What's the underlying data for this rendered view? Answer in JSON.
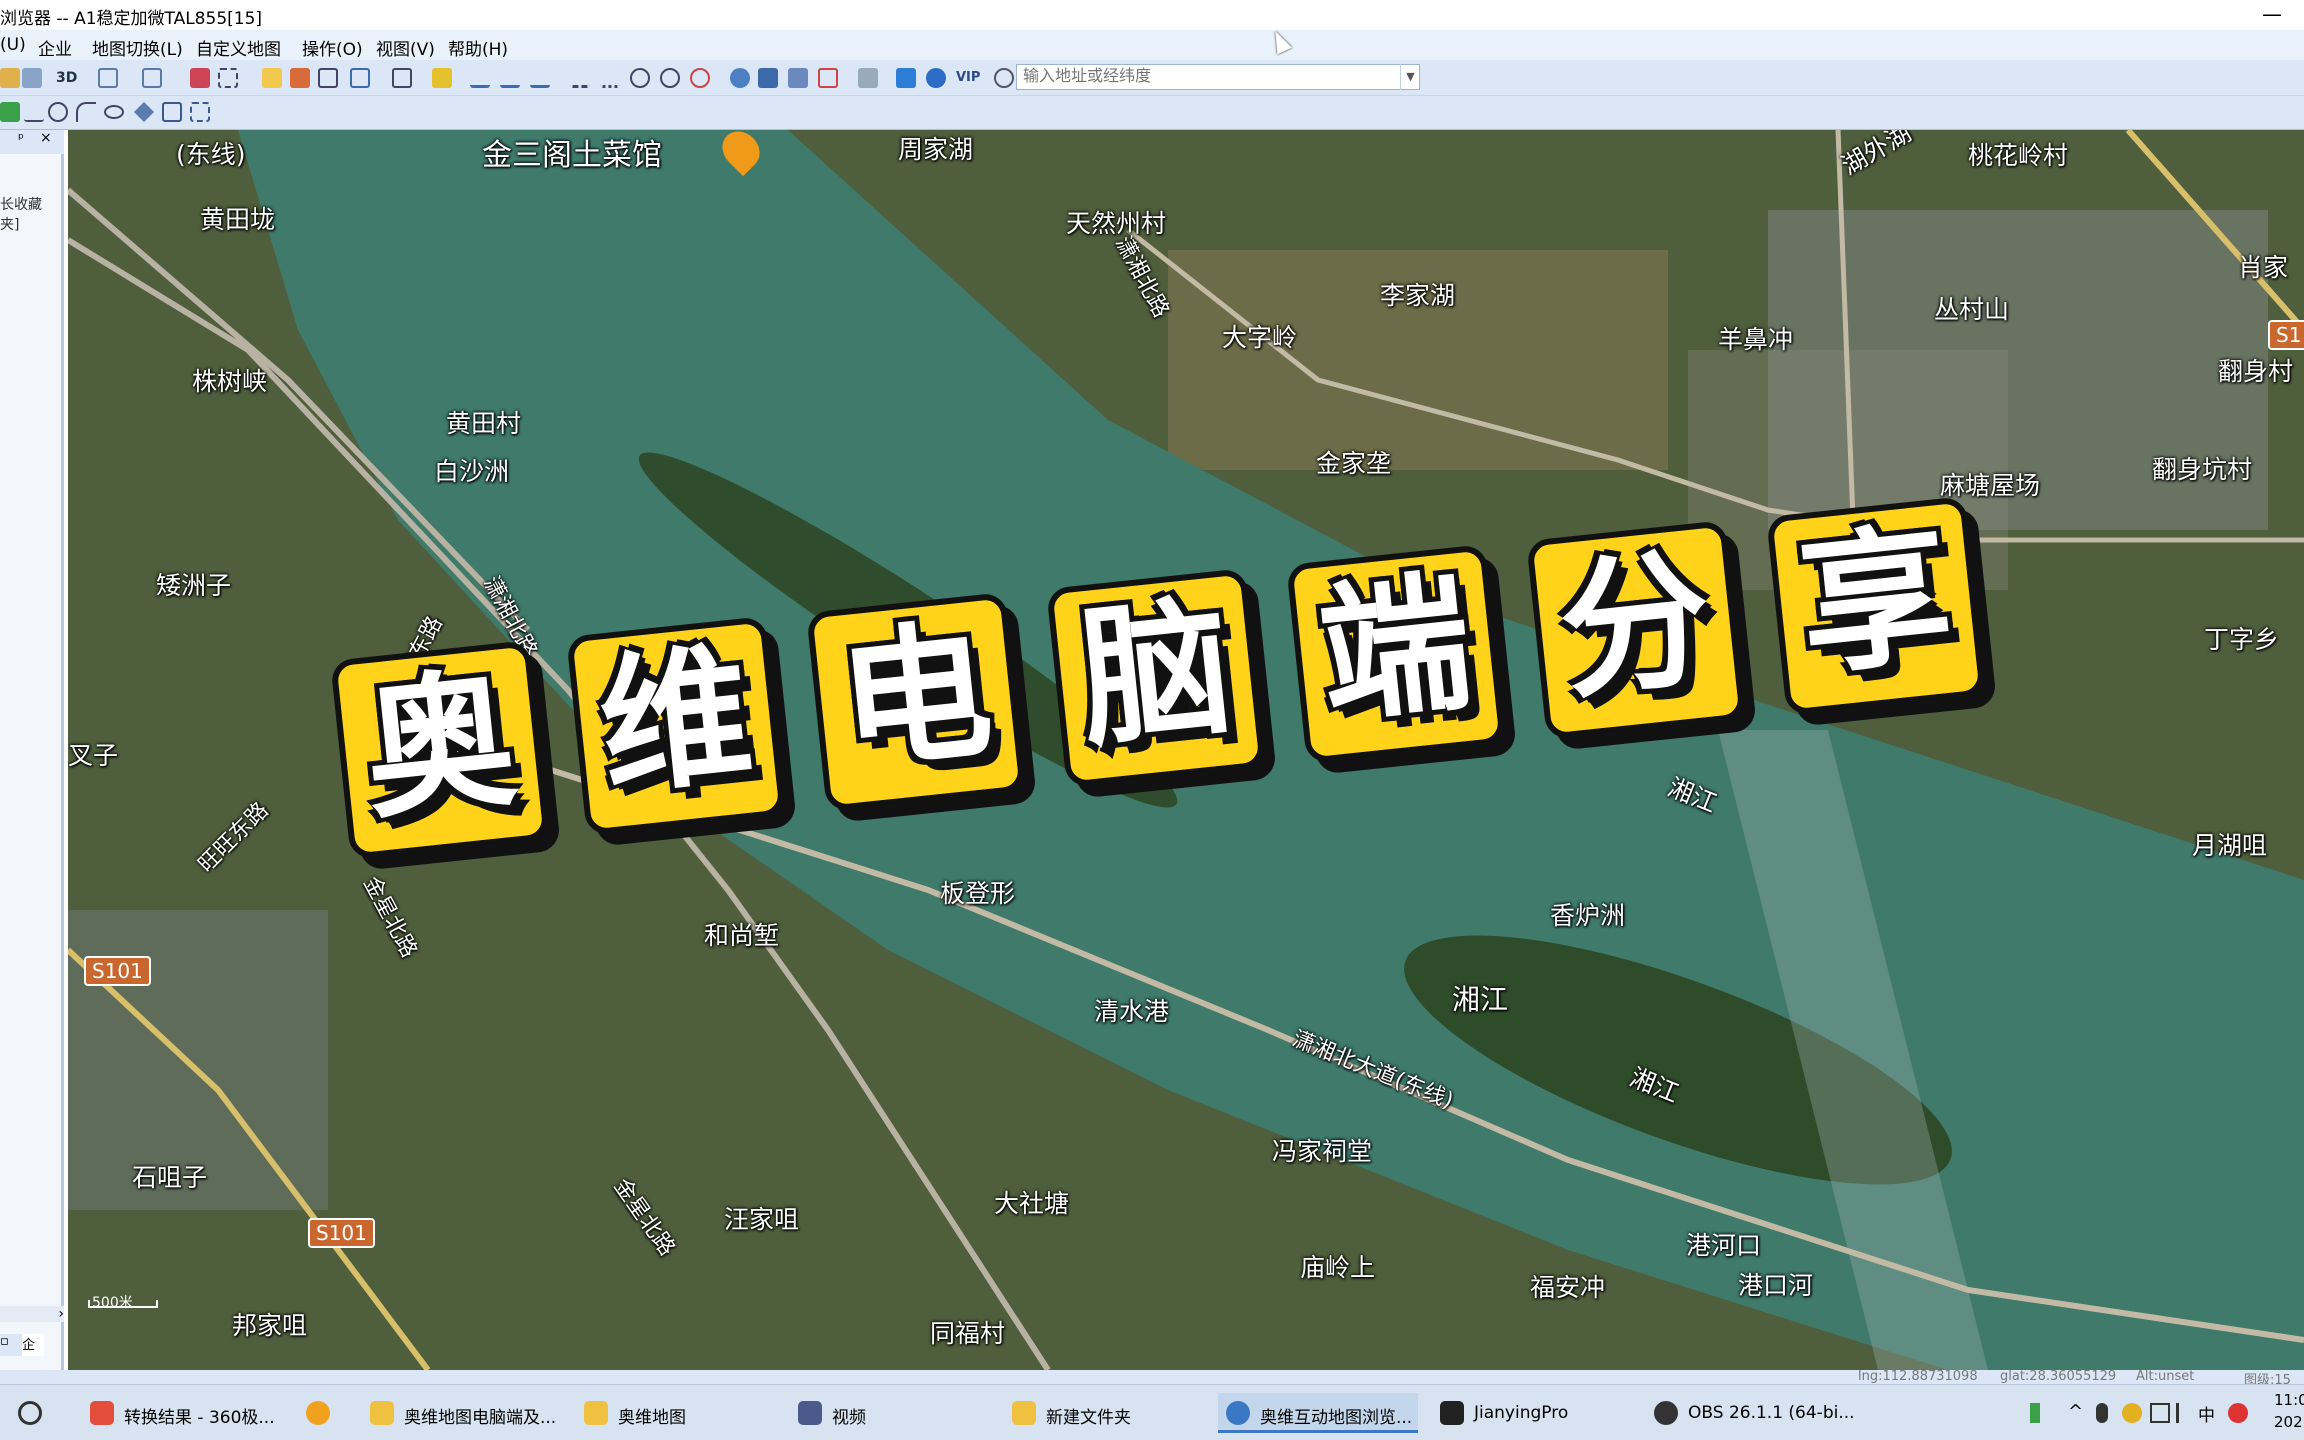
{
  "window": {
    "title": "浏览器 -- A1稳定加微TAL855[15]",
    "minimize": "—"
  },
  "menu": [
    "(U)",
    "企业",
    "地图切换(L)",
    "自定义地图",
    "操作(O)",
    "视图(V)",
    "帮助(H)"
  ],
  "toolbar": {
    "label_3d": "3D",
    "label_vip": "VIP",
    "address_placeholder": "输入地址或经纬度"
  },
  "left_panel": {
    "pin": "ᵖ",
    "close": "×",
    "favorites": "长收藏夹]",
    "scroll_right": "›"
  },
  "map_labels": [
    {
      "text": "(东线)"
    },
    {
      "text": "金三阁土菜馆"
    },
    {
      "text": "周家湖"
    },
    {
      "text": "湖外湖"
    },
    {
      "text": "桃花岭村"
    },
    {
      "text": "黄田垅"
    },
    {
      "text": "天然州村"
    },
    {
      "text": "潇湘北路"
    },
    {
      "text": "李家湖"
    },
    {
      "text": "大字岭"
    },
    {
      "text": "羊鼻冲"
    },
    {
      "text": "丛村山"
    },
    {
      "text": "肖家"
    },
    {
      "text": "翻身村"
    },
    {
      "text": "株树峡"
    },
    {
      "text": "黄田村"
    },
    {
      "text": "白沙洲"
    },
    {
      "text": "金家垄"
    },
    {
      "text": "麻塘屋场"
    },
    {
      "text": "翻身坑村"
    },
    {
      "text": "矮洲子"
    },
    {
      "text": "旺旺东路"
    },
    {
      "text": "潇湘北路"
    },
    {
      "text": "丁字乡"
    },
    {
      "text": "叉子"
    },
    {
      "text": "湘江"
    },
    {
      "text": "月湖咀"
    },
    {
      "text": "旺旺东路"
    },
    {
      "text": "金星北路"
    },
    {
      "text": "板登形"
    },
    {
      "text": "和尚堑"
    },
    {
      "text": "香炉洲"
    },
    {
      "text": "湘江"
    },
    {
      "text": "清水港"
    },
    {
      "text": "潇湘北大道(东线)"
    },
    {
      "text": "湘江"
    },
    {
      "text": "冯家祠堂"
    },
    {
      "text": "石咀子"
    },
    {
      "text": "汪家咀"
    },
    {
      "text": "大社塘"
    },
    {
      "text": "金星北路"
    },
    {
      "text": "港河口"
    },
    {
      "text": "庙岭上"
    },
    {
      "text": "福安冲"
    },
    {
      "text": "港口河"
    },
    {
      "text": "邦家咀"
    },
    {
      "text": "同福村"
    }
  ],
  "road_shields": [
    "S101",
    "S101",
    "S1"
  ],
  "scale": "500米",
  "banner": [
    "奥",
    "维",
    "电",
    "脑",
    "端",
    "分",
    "享"
  ],
  "status": {
    "lng": "lng:112.88731098",
    "lat": "glat:28.36055129",
    "alt": "Alt:unset",
    "level": "图级:15"
  },
  "taskbar": [
    {
      "label": "转换结果 - 360极..."
    },
    {
      "label": ""
    },
    {
      "label": "奥维地图电脑端及..."
    },
    {
      "label": "奥维地图"
    },
    {
      "label": "视频"
    },
    {
      "label": "新建文件夹"
    },
    {
      "label": "奥维互动地图浏览..."
    },
    {
      "label": "JianyingPro"
    },
    {
      "label": "OBS 26.1.1 (64-bi..."
    }
  ],
  "tray": {
    "ime": "中",
    "time": "11:0",
    "date": "202"
  },
  "colors": {
    "banner_fill": "#ffd31a",
    "banner_outline": "#111111",
    "road_shield": "#c9672e",
    "water": "#3f7a6a"
  }
}
